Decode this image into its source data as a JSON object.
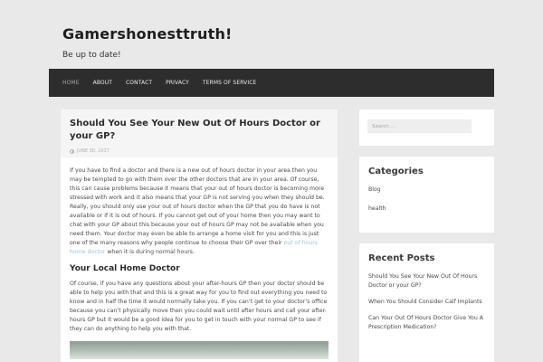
{
  "site": {
    "title": "Gamershonesttruth!",
    "tagline": "Be up to date!"
  },
  "nav": {
    "items": [
      {
        "label": "HOME",
        "active": true
      },
      {
        "label": "ABOUT"
      },
      {
        "label": "CONTACT"
      },
      {
        "label": "PRIVACY"
      },
      {
        "label": "TERMS OF SERVICE"
      }
    ]
  },
  "post": {
    "title": "Should You See Your New Out Of Hours Doctor or your GP?",
    "date": "JUNE 30, 2017",
    "para1_before_link": "If you have to find a doctor and there is a new out of hours doctor in your area then you may be tempted to go with them over the other doctors that are in your area. Of course, this can cause problems because it means that your out of hours doctor is becoming more stressed with work and it also means that your GP is not serving you when they should be. Really, you should only use your out of hours doctor when the GP that you do have is not available or if it is out of hours. If you cannot get out of your home then you may want to chat with your GP about this because your out of hours GP may not be available when you need them. Your doctor may even be able to arrange a home visit for you and this is just one of the many reasons why people continue to choose their GP over their ",
    "para1_link": "out of hours home doctor",
    "para1_after_link": " when it is during normal hours.",
    "subheading": "Your Local Home Doctor",
    "para2": "Of course, if you have any questions about your after-hours GP then your doctor should be able to help you with that and this is a great way for you to find out everything you need to know and in half the time it would normally take you. If you can’t get to your doctor’s office because you can’t physically move then you could wait until after hours and call your after-hours GP but it would be a good idea for you to get in touch with your normal GP to see if they can do anything to help you with that."
  },
  "sidebar": {
    "search_placeholder": "Search ...",
    "categories_title": "Categories",
    "categories": [
      "Blog",
      "health"
    ],
    "recent_title": "Recent Posts",
    "recent": [
      "Should You See Your New Out Of Hours Doctor or your GP?",
      "When You Should Consider Calf Implants",
      "Can Your Out Of Hours Doctor Give You A Prescription Medication?"
    ]
  },
  "colors": {
    "nav_bg": "#2d2d2d",
    "link": "#9cc5dd"
  }
}
